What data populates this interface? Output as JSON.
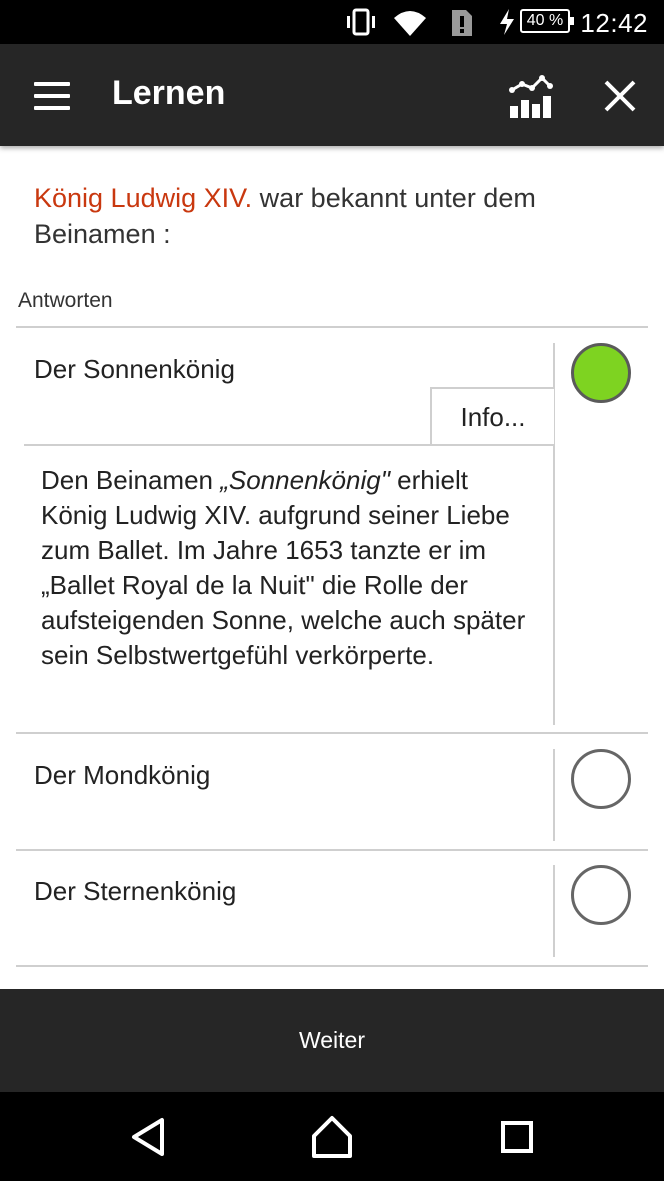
{
  "status_bar": {
    "time": "12:42",
    "battery": "40 %"
  },
  "app_bar": {
    "title": "Lernen",
    "icons": [
      "menu-icon",
      "stats-chart-icon",
      "close-icon"
    ]
  },
  "question": {
    "highlight": "König Ludwig XIV.",
    "text": " war bekannt unter dem Beinamen :"
  },
  "answers_label": "Antworten",
  "answers": [
    {
      "label": "Der Sonnenkönig",
      "selected": true,
      "info_button": "Info...",
      "info": {
        "part1": "Den Beinamen ",
        "italic": "„Sonnenkönig\"",
        "part2": " erhielt König Ludwig XIV. aufgrund seiner Liebe zum Ballet. Im Jahre 1653 tanzte er im „Ballet Royal de la Nuit\" die Rolle der aufsteigenden Sonne, welche auch später sein Selbstwertgefühl verkörperte."
      }
    },
    {
      "label": "Der Mondkönig",
      "selected": false
    },
    {
      "label": "Der Sternenkönig",
      "selected": false
    }
  ],
  "next_button": "Weiter",
  "colors": {
    "highlight": "#c9380f",
    "selected": "#7ed321",
    "bar": "#262626"
  }
}
